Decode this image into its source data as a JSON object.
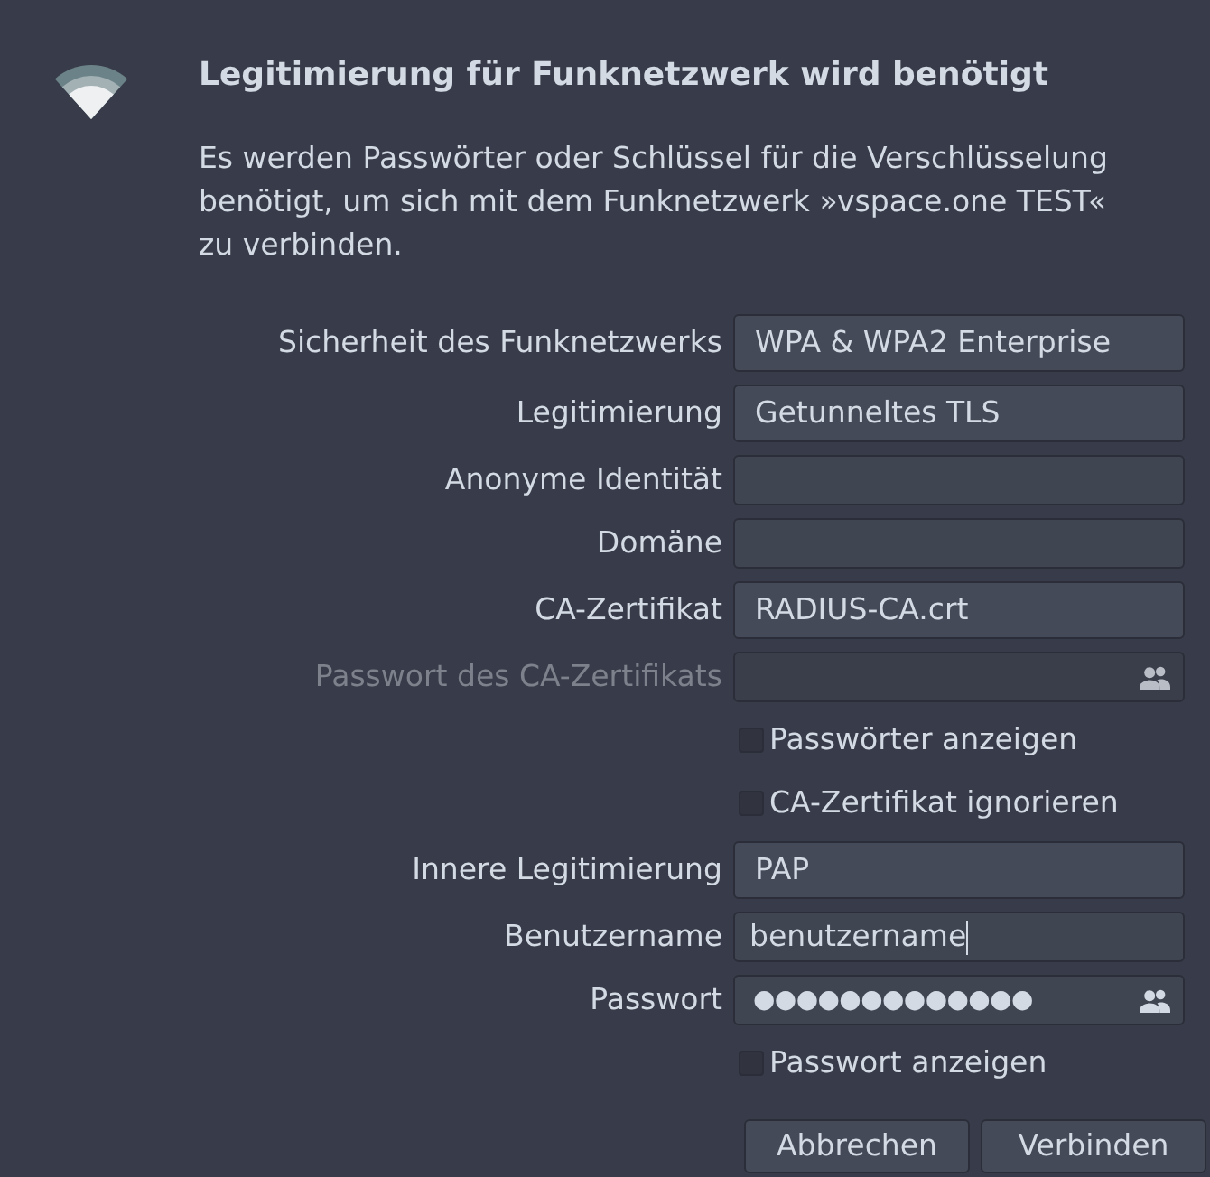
{
  "header": {
    "title": "Legitimierung für Funknetzwerk wird benötigt",
    "message": "Es werden Passwörter oder Schlüssel für die Verschlüsselung benötigt, um sich mit dem Funknetzwerk »vspace.one TEST« zu verbinden."
  },
  "form": [
    {
      "kind": "combo",
      "label": "Sicherheit des Funknetzwerks",
      "value": "WPA & WPA2 Enterprise",
      "disabled": false,
      "focused": false
    },
    {
      "kind": "combo",
      "label": "Legitimierung",
      "value": "Getunneltes TLS",
      "disabled": false,
      "focused": false
    },
    {
      "kind": "entry",
      "label": "Anonyme Identität",
      "disabled": false,
      "focused": false
    },
    {
      "kind": "entry",
      "label": "Domäne",
      "disabled": false,
      "focused": false
    },
    {
      "kind": "file",
      "label": "CA-Zertifikat",
      "value": "RADIUS-CA.crt",
      "disabled": false,
      "focused": false
    },
    {
      "kind": "password",
      "label": "Passwort des CA-Zertifikats",
      "disabled": true,
      "focused": false
    },
    {
      "kind": "checkbox",
      "label": "Passwörter anzeigen",
      "checked": false,
      "disabled": false,
      "focused": false
    },
    {
      "kind": "checkbox",
      "label": "CA-Zertifikat ignorieren",
      "checked": false,
      "disabled": false,
      "focused": false
    },
    {
      "kind": "combo",
      "label": "Innere Legitimierung",
      "value": "PAP",
      "disabled": false,
      "focused": false
    },
    {
      "kind": "entry",
      "label": "Benutzername",
      "value": "benutzername",
      "disabled": false,
      "focused": true
    },
    {
      "kind": "password",
      "label": "Passwort",
      "value": "●●●●●●●●●●●●●",
      "disabled": false,
      "focused": false
    },
    {
      "kind": "checkbox",
      "label": "Passwort anzeigen",
      "checked": false,
      "disabled": false,
      "focused": false
    }
  ],
  "buttons": [
    {
      "label": "Abbrechen"
    },
    {
      "label": "Verbinden"
    }
  ]
}
